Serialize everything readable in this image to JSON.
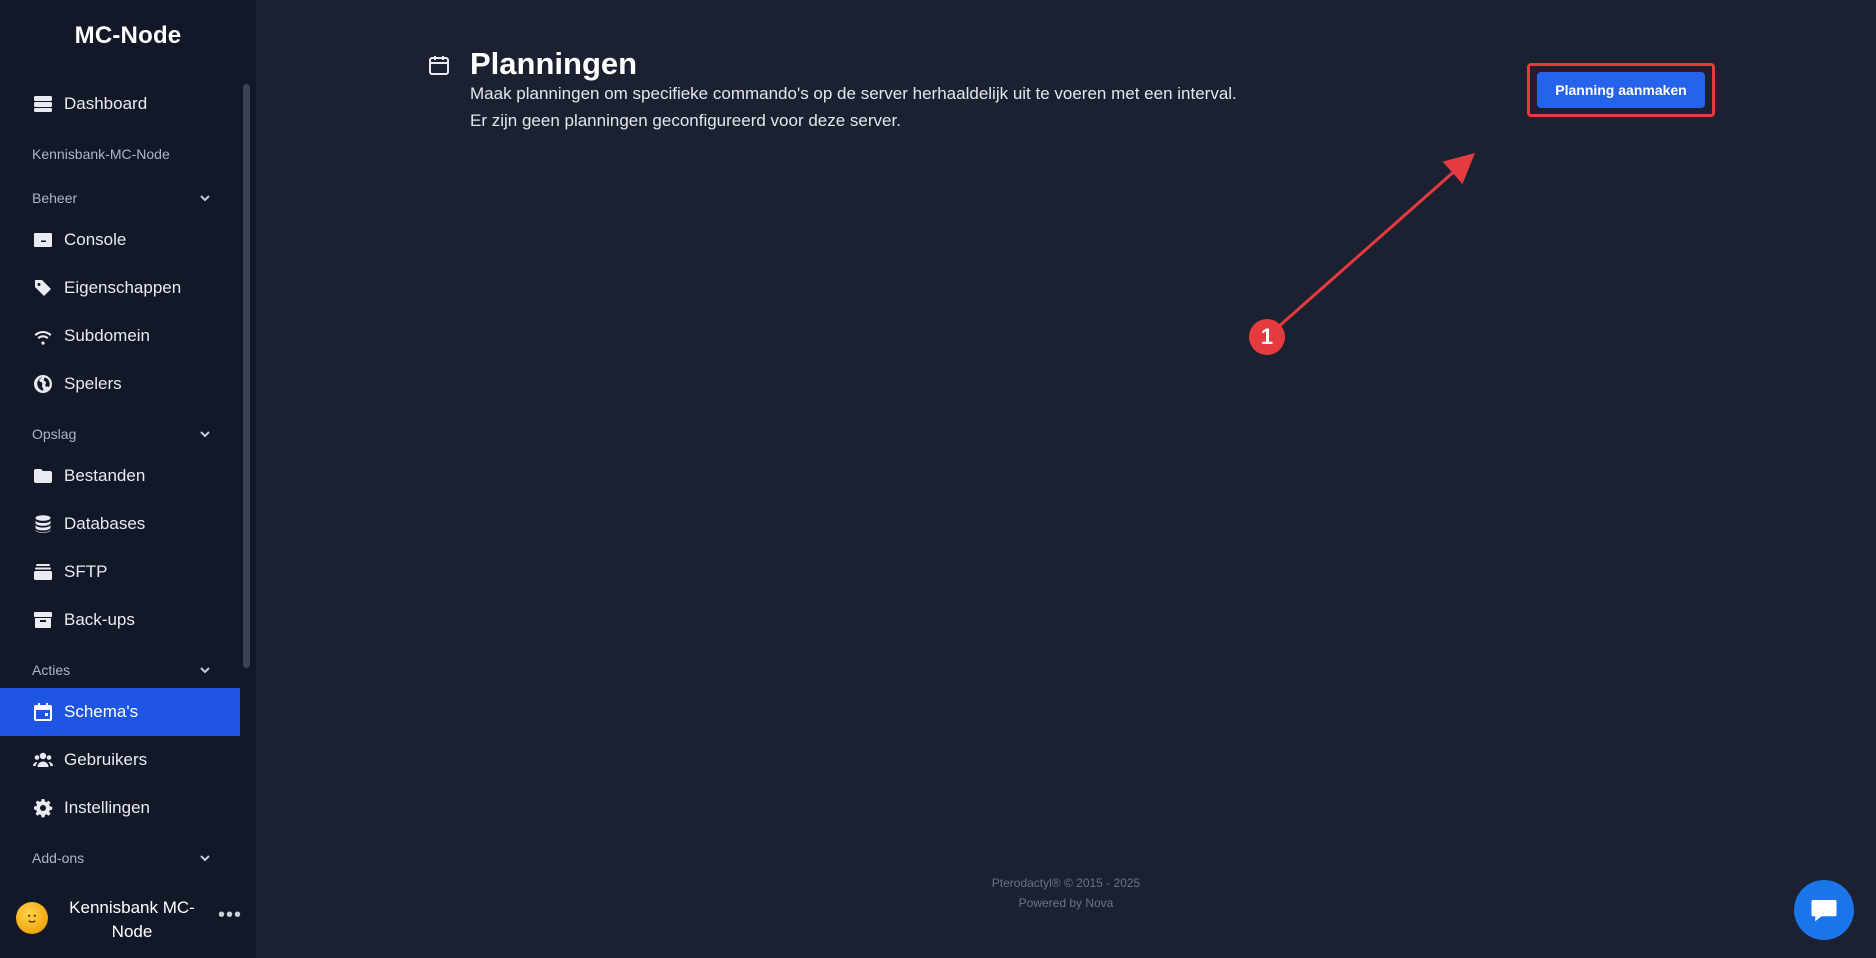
{
  "sidebar": {
    "brand": "MC-Node",
    "server_name": "Kennisbank-MC-Node",
    "items": {
      "dashboard": {
        "label": "Dashboard",
        "icon": "server-icon"
      },
      "console": {
        "label": "Console",
        "icon": "terminal-icon"
      },
      "properties": {
        "label": "Eigenschappen",
        "icon": "tag-icon"
      },
      "subdomain": {
        "label": "Subdomein",
        "icon": "wifi-icon"
      },
      "players": {
        "label": "Spelers",
        "icon": "globe-icon"
      },
      "files": {
        "label": "Bestanden",
        "icon": "folder-icon"
      },
      "databases": {
        "label": "Databases",
        "icon": "database-icon"
      },
      "sftp": {
        "label": "SFTP",
        "icon": "layers-icon"
      },
      "backups": {
        "label": "Back-ups",
        "icon": "archive-icon"
      },
      "schedules": {
        "label": "Schema's",
        "icon": "calendar-icon",
        "active": true
      },
      "users": {
        "label": "Gebruikers",
        "icon": "users-icon"
      },
      "settings": {
        "label": "Instellingen",
        "icon": "gear-icon"
      }
    },
    "sections": {
      "beheer": "Beheer",
      "opslag": "Opslag",
      "acties": "Acties",
      "addons": "Add-ons"
    },
    "user": {
      "name": "Kennisbank MC-Node",
      "menu": "•••"
    }
  },
  "main": {
    "title": "Planningen",
    "description": "Maak planningen om specifieke commando's op de server herhaaldelijk uit te voeren met een interval.",
    "empty_message": "Er zijn geen planningen geconfigureerd voor deze server.",
    "create_button": "Planning aanmaken",
    "annotation_number": "1",
    "footer": {
      "copyright": "Pterodactyl® © 2015 - 2025",
      "powered": "Powered by Nova"
    }
  },
  "colors": {
    "sidebar_bg": "#121827",
    "main_bg": "#1b2131",
    "active_item": "#1f55e3",
    "primary_button": "#2563eb",
    "annotation_red": "#e53b3f",
    "chat_button": "#1b74e8"
  }
}
